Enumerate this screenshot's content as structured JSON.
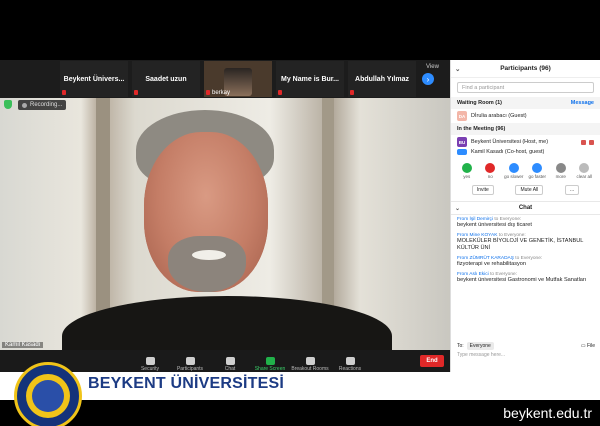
{
  "thumbnails": [
    {
      "name": "Beykent  Ünivers..."
    },
    {
      "name": "Saadet uzun"
    },
    {
      "name": "berkay"
    },
    {
      "name": "My Name is Bur..."
    },
    {
      "name": "Abdullah Yılmaz"
    }
  ],
  "view_label": "View",
  "recording_label": "Recording...",
  "speaker_name": "Kamil Kasadı",
  "toolbar": {
    "items": [
      "Security",
      "Participants",
      "Chat",
      "Share Screen",
      "Breakout Rooms",
      "Reactions"
    ],
    "participants_count": "97",
    "end_label": "End"
  },
  "panel": {
    "title": "Participants (96)",
    "find_placeholder": "Find a participant",
    "waiting_room": "Waiting Room (1)",
    "message_label": "Message",
    "waiting_person": "Dİrulia arabacı (Guest)",
    "in_meeting": "In the Meeting (96)",
    "host": {
      "initials": "BU",
      "name": "Beykent Üniversitesi (Host, me)"
    },
    "cohost_partial": "Kamil Kasadı (Co-host, guest)",
    "reactions": [
      "yes",
      "no",
      "go slower",
      "go faster",
      "more",
      "clear all"
    ],
    "invite_label": "Invite",
    "mute_all_label": "Mute All",
    "more_label": "..."
  },
  "chat": {
    "title": "Chat",
    "messages": [
      {
        "from": "From İşil Demirçi",
        "to": "to Everyone:",
        "text": "beykent üniversitesi dış ticaret"
      },
      {
        "from": "From Mine KOYAK",
        "to": "to Everyone:",
        "text": "MOLEKÜLER BİYOLOJİ VE GENETİK, İSTANBUL KÜLTÜR ÜNİ"
      },
      {
        "from": "From ZÜMRÜT KARADAŞ",
        "to": "to Everyone:",
        "text": "fizyoterapi ve rehabilitasyon"
      },
      {
        "from": "From Aslı Ekici",
        "to": "to Everyone:",
        "text": "beykent üniversitesi Gastronomi ve Mutfak Sanatları"
      }
    ],
    "to_label": "To:",
    "to_value": "Everyone",
    "file_label": "File",
    "input_placeholder": "Type message here..."
  },
  "footer": {
    "brand": "BEYKENT ÜNİVERSİTESİ",
    "url": "beykent.edu.tr"
  },
  "colors": {
    "brand_blue": "#1c3b84",
    "gold": "#f0c419",
    "end_red": "#e02828",
    "zoom_blue": "#0e71eb"
  }
}
